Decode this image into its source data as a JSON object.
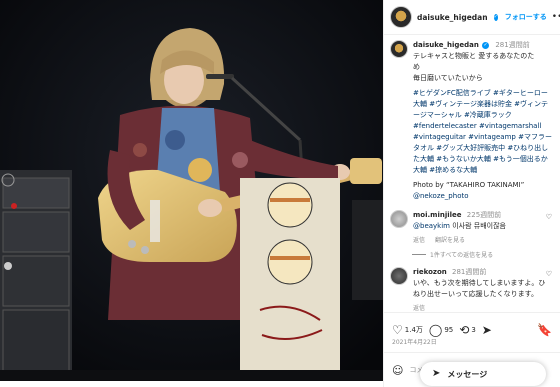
{
  "header": {
    "username": "daisuke_higedan",
    "follow_label": "フォローする",
    "more_glyph": "•••"
  },
  "caption": {
    "username": "daisuke_higedan",
    "time": "281週間前",
    "line1": "テレキャスと物販と 愛するあなたのた",
    "line2": "め",
    "line3": "毎日磨いていたいから",
    "hashtags": "#ヒゲダンFC配信ライブ #ギターヒーロー大輔 #ヴィンテージ楽器は貯金 #ヴィンテージマーシャル #冷蔵庫ラック #fendertelecaster #vintagemarshall #vintageguitar #vintageamp #マフラータオル #グッズ大好評販売中 #ひねり出した大輔 #もうないか大輔 #もう一個出るか大輔 #掠めるな大輔",
    "photo_by": "Photo by “TAKAHIRO TAKINAMI”",
    "photo_handle": "@nekoze_photo"
  },
  "comments": [
    {
      "username": "moi.minjilee",
      "time": "225週間前",
      "mention": "@beaykim",
      "text": " 이사람 뮤배이잖음",
      "reply": "返信",
      "translate": "翻訳を見る",
      "view_replies": "1件すべての返信を見る"
    },
    {
      "username": "riekozon",
      "time": "281週間前",
      "text": "いや、もう次を期待してしまいますよ。ひねり出せーいって応援したくなります。",
      "reply": "返信"
    }
  ],
  "actions": {
    "likes": "1.4万",
    "comments_count": "95",
    "shares_count": "3"
  },
  "date": "2021年4月22日",
  "comment_bar": {
    "placeholder": "コメントを追加..."
  },
  "messages": {
    "label": "メッセージ"
  },
  "colors": {
    "link": "#00376b",
    "follow": "#0095f6",
    "muted": "#8e8e8e"
  },
  "icons": [
    "heart-icon",
    "comment-icon",
    "share-icon",
    "bookmark-icon",
    "emoji-icon",
    "send-icon",
    "verified-icon",
    "more-icon",
    "zoom-icon"
  ]
}
